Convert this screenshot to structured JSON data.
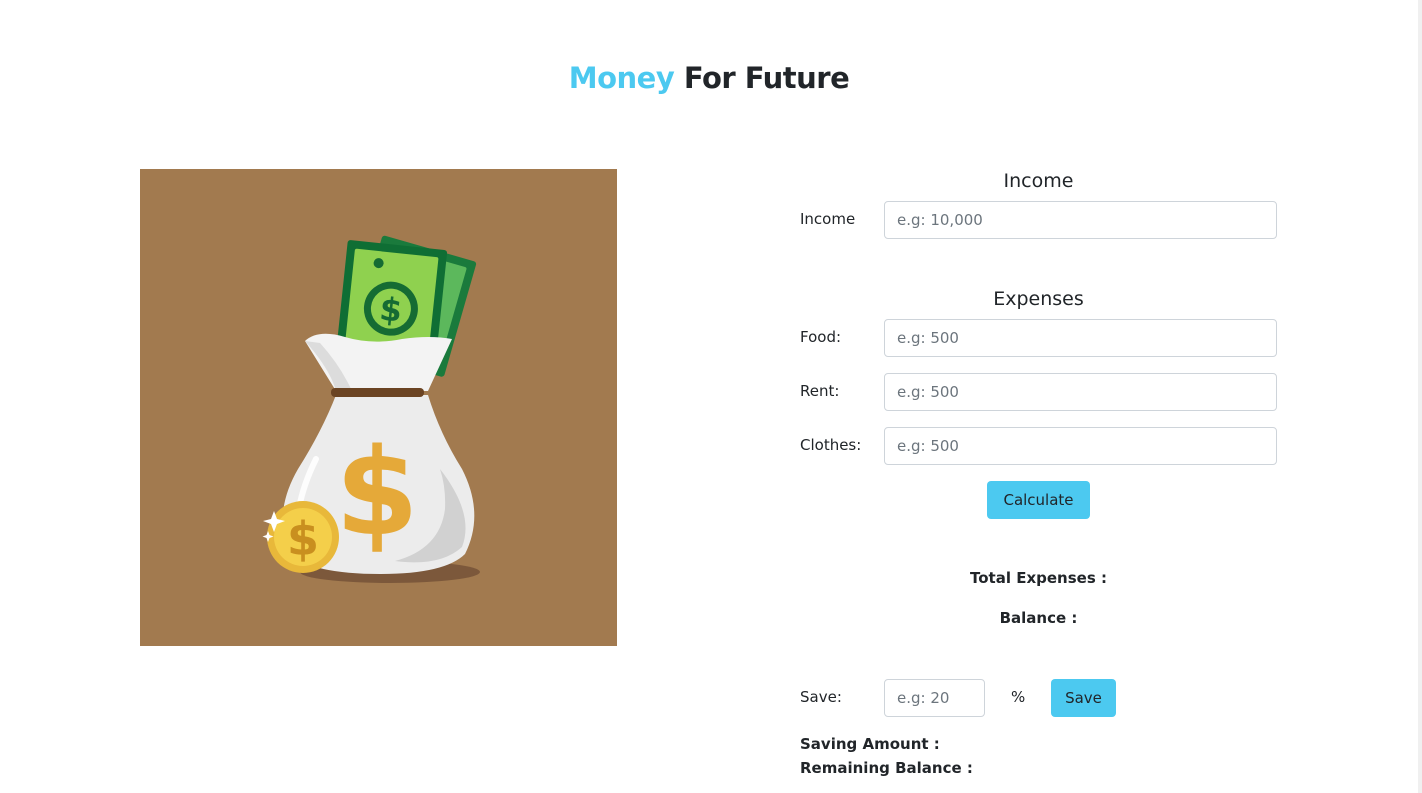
{
  "header": {
    "title_accent": "Money",
    "title_rest": "For Future",
    "accent_color": "#4cc9f0"
  },
  "illustration": {
    "background_color": "#a27a4f",
    "icon": "money-bag-icon"
  },
  "income_section": {
    "heading": "Income",
    "income_label": "Income",
    "income_placeholder": "e.g: 10,000",
    "income_value": ""
  },
  "expenses_section": {
    "heading": "Expenses",
    "food_label": "Food:",
    "food_placeholder": "e.g: 500",
    "rent_label": "Rent:",
    "rent_placeholder": "e.g: 500",
    "clothes_label": "Clothes:",
    "clothes_placeholder": "e.g: 500",
    "calculate_label": "Calculate"
  },
  "results": {
    "total_expenses_label": "Total Expenses :",
    "balance_label": "Balance :"
  },
  "savings": {
    "save_label": "Save:",
    "save_placeholder": "e.g: 20",
    "percent_symbol": "%",
    "save_button_label": "Save",
    "saving_amount_label": "Saving Amount :",
    "remaining_balance_label": "Remaining Balance :"
  }
}
